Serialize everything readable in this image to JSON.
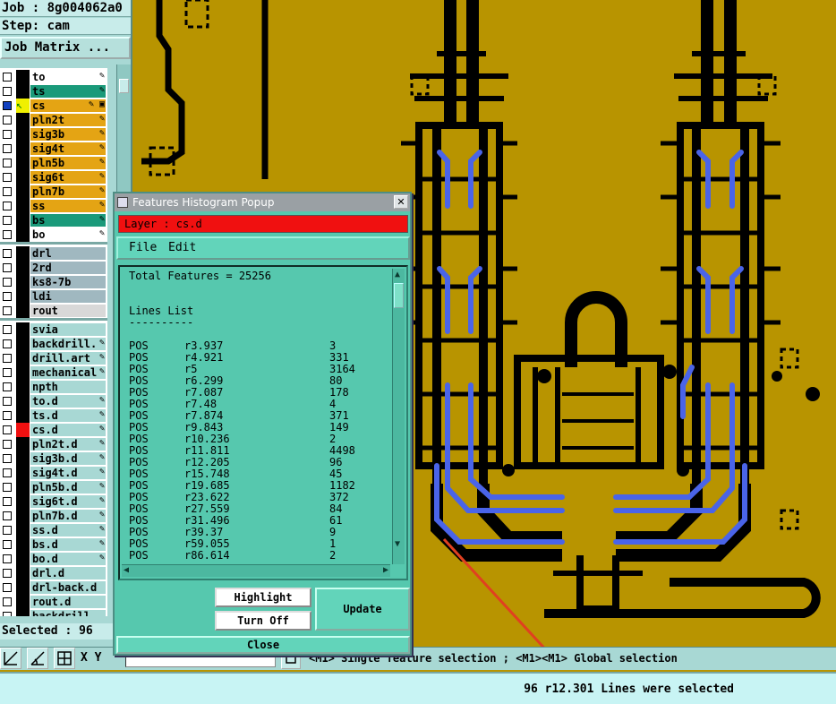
{
  "job": {
    "job_line": "Job : 8g004062a0",
    "step_line": "Step: cam",
    "matrix_button": "Job Matrix ..."
  },
  "layers": [
    {
      "name": "to",
      "bg": "#ffffff",
      "tag": "✎"
    },
    {
      "name": "ts",
      "bg": "#1a9a7a",
      "tag": "✎"
    },
    {
      "name": "cs",
      "bg": "#e4a414",
      "tag": "✎ ▣"
    },
    {
      "name": "pln2t",
      "bg": "#e4a414",
      "tag": "✎"
    },
    {
      "name": "sig3b",
      "bg": "#e4a414",
      "tag": "✎"
    },
    {
      "name": "sig4t",
      "bg": "#e4a414",
      "tag": "✎"
    },
    {
      "name": "pln5b",
      "bg": "#e4a414",
      "tag": "✎"
    },
    {
      "name": "sig6t",
      "bg": "#e4a414",
      "tag": "✎"
    },
    {
      "name": "pln7b",
      "bg": "#e4a414",
      "tag": "✎"
    },
    {
      "name": "ss",
      "bg": "#e4a414",
      "tag": "✎"
    },
    {
      "name": "bs",
      "bg": "#1a9a7a",
      "tag": "✎"
    },
    {
      "name": "bo",
      "bg": "#ffffff",
      "tag": "✎"
    },
    {
      "name": "drl",
      "bg": "#a0b8c0",
      "tag": ""
    },
    {
      "name": "2rd",
      "bg": "#a0b8c0",
      "tag": ""
    },
    {
      "name": "ks8-7b",
      "bg": "#a0b8c0",
      "tag": ""
    },
    {
      "name": "ldi",
      "bg": "#a0b8c0",
      "tag": ""
    },
    {
      "name": "rout",
      "bg": "#d8d8d8",
      "tag": ""
    },
    {
      "name": "svia",
      "bg": "#a8d8d4",
      "tag": ""
    },
    {
      "name": "backdrill.",
      "bg": "#a8d8d4",
      "tag": "✎"
    },
    {
      "name": "drill.art",
      "bg": "#a8d8d4",
      "tag": "✎"
    },
    {
      "name": "mechanical",
      "bg": "#a8d8d4",
      "tag": "✎"
    },
    {
      "name": "npth",
      "bg": "#a8d8d4",
      "tag": ""
    },
    {
      "name": "to.d",
      "bg": "#a8d8d4",
      "tag": "✎"
    },
    {
      "name": "ts.d",
      "bg": "#a8d8d4",
      "tag": "✎"
    },
    {
      "name": "cs.d",
      "bg": "#a8d8d4",
      "tag": "✎"
    },
    {
      "name": "pln2t.d",
      "bg": "#a8d8d4",
      "tag": "✎"
    },
    {
      "name": "sig3b.d",
      "bg": "#a8d8d4",
      "tag": "✎"
    },
    {
      "name": "sig4t.d",
      "bg": "#a8d8d4",
      "tag": "✎"
    },
    {
      "name": "pln5b.d",
      "bg": "#a8d8d4",
      "tag": "✎"
    },
    {
      "name": "sig6t.d",
      "bg": "#a8d8d4",
      "tag": "✎"
    },
    {
      "name": "pln7b.d",
      "bg": "#a8d8d4",
      "tag": "✎"
    },
    {
      "name": "ss.d",
      "bg": "#a8d8d4",
      "tag": "✎"
    },
    {
      "name": "bs.d",
      "bg": "#a8d8d4",
      "tag": "✎"
    },
    {
      "name": "bo.d",
      "bg": "#a8d8d4",
      "tag": "✎"
    },
    {
      "name": "drl.d",
      "bg": "#a8d8d4",
      "tag": ""
    },
    {
      "name": "drl-back.d",
      "bg": "#a8d8d4",
      "tag": ""
    },
    {
      "name": "rout.d",
      "bg": "#a8d8d4",
      "tag": ""
    },
    {
      "name": "backdrill",
      "bg": "#a8d8d4",
      "tag": ""
    }
  ],
  "selected": "Selected : 96",
  "popup": {
    "title": "Features Histogram Popup",
    "layer": "Layer :  cs.d",
    "menu_file": "File",
    "menu_edit": "Edit",
    "total": "Total Features = 25256",
    "list_heading": "Lines List",
    "underline": "----------",
    "rows": [
      [
        "POS",
        "r3.937",
        "3"
      ],
      [
        "POS",
        "r4.921",
        "331"
      ],
      [
        "POS",
        "r5",
        "3164"
      ],
      [
        "POS",
        "r6.299",
        "80"
      ],
      [
        "POS",
        "r7.087",
        "178"
      ],
      [
        "POS",
        "r7.48",
        "4"
      ],
      [
        "POS",
        "r7.874",
        "371"
      ],
      [
        "POS",
        "r9.843",
        "149"
      ],
      [
        "POS",
        "r10.236",
        "2"
      ],
      [
        "POS",
        "r11.811",
        "4498"
      ],
      [
        "POS",
        "r12.205",
        "96"
      ],
      [
        "POS",
        "r15.748",
        "45"
      ],
      [
        "POS",
        "r19.685",
        "1182"
      ],
      [
        "POS",
        "r23.622",
        "372"
      ],
      [
        "POS",
        "r27.559",
        "84"
      ],
      [
        "POS",
        "r31.496",
        "61"
      ],
      [
        "POS",
        "r39.37",
        "9"
      ],
      [
        "POS",
        "r59.055",
        "1"
      ],
      [
        "POS",
        "r86.614",
        "2"
      ]
    ],
    "highlight": "Highlight",
    "turn_off": "Turn Off",
    "update": "Update",
    "close": "Close"
  },
  "bottom": {
    "xy_label": "X Y",
    "prompt": "<M1> Single feature selection ; <M1><M1> Global selection",
    "status": "96 r12.301 Lines were selected"
  },
  "colors": {
    "board": "#b89400",
    "trace": "#000000",
    "highlight_trace": "#4a64e8",
    "annotation_arrow": "#e04020"
  }
}
